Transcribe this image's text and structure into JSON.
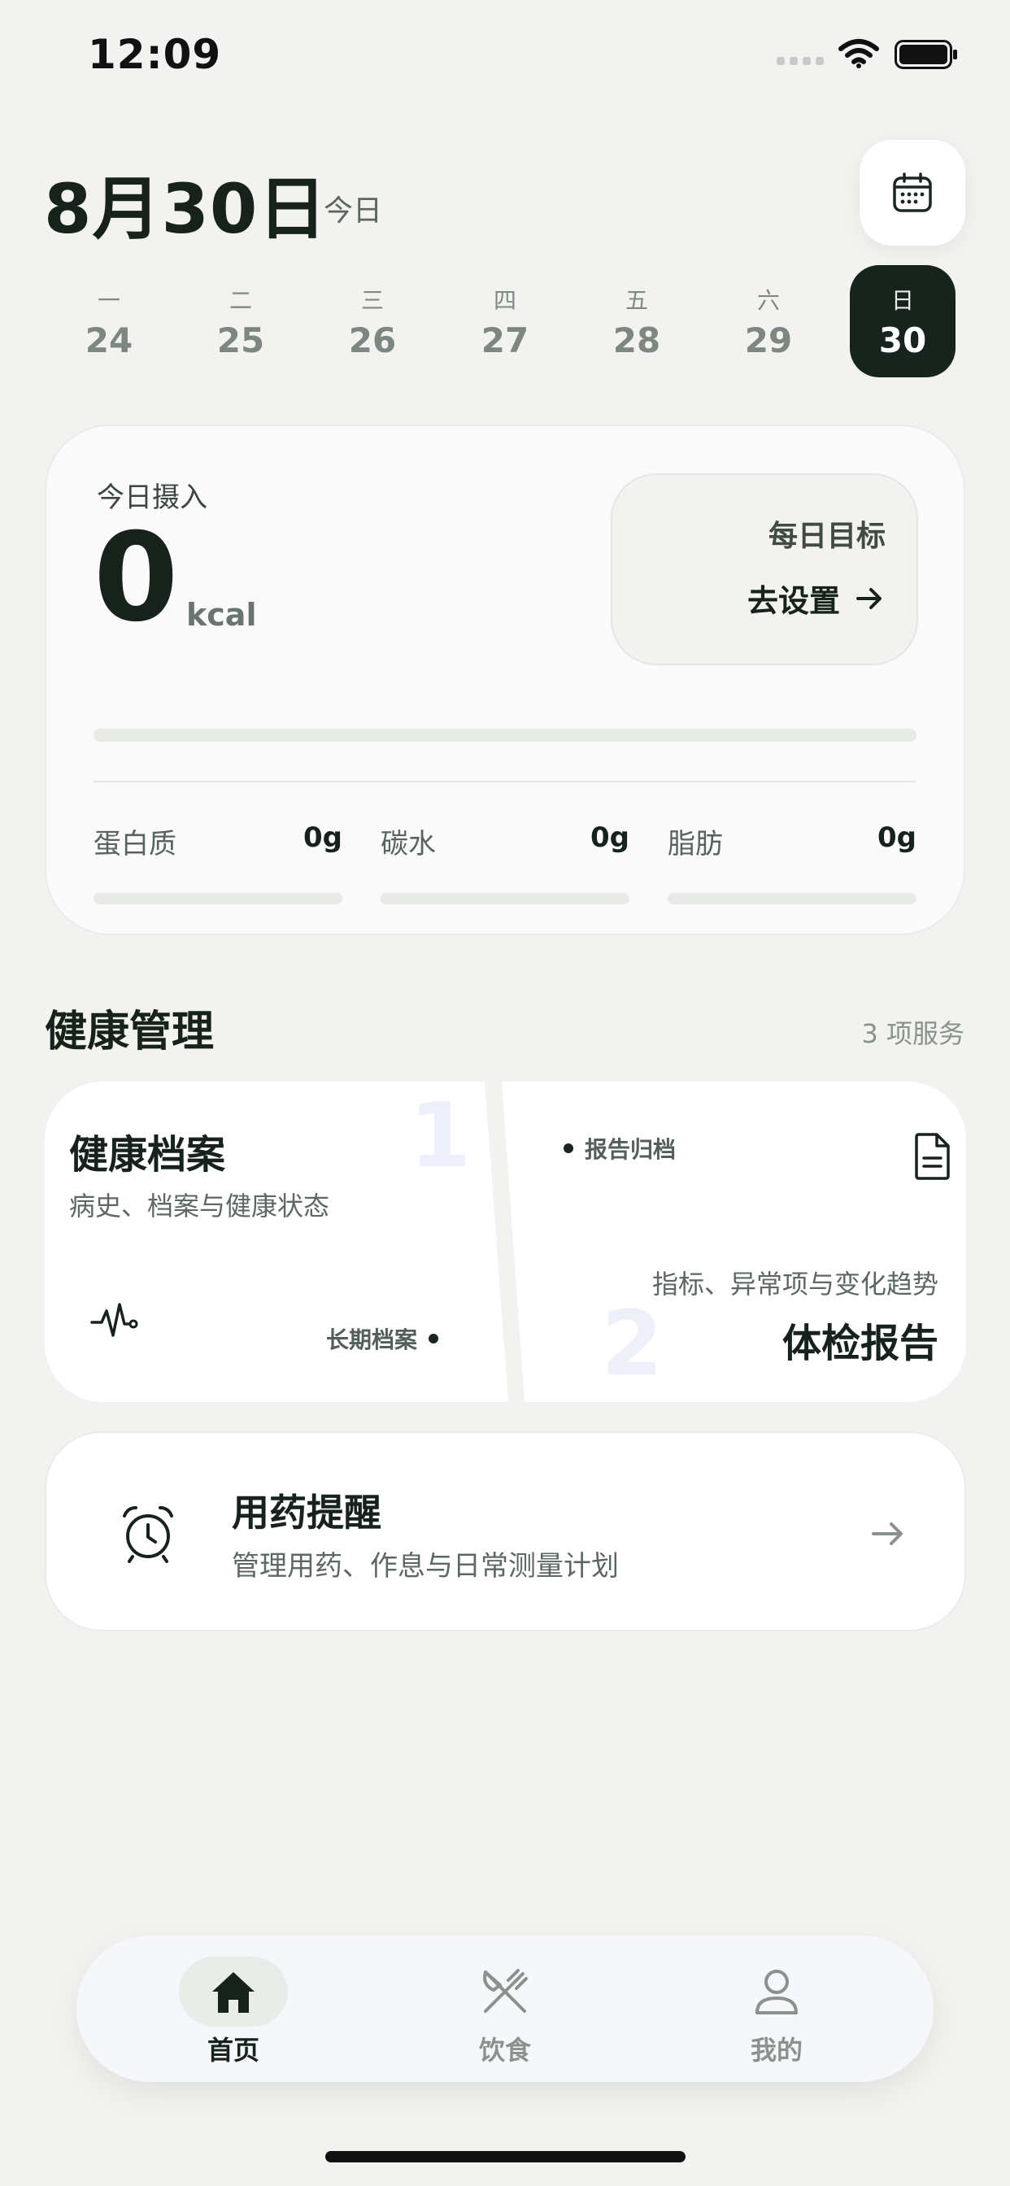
{
  "status_bar": {
    "time": "12:09"
  },
  "header": {
    "date": "8月30日",
    "today_label": "今日"
  },
  "week": [
    {
      "dow": "一",
      "day": "24"
    },
    {
      "dow": "二",
      "day": "25"
    },
    {
      "dow": "三",
      "day": "26"
    },
    {
      "dow": "四",
      "day": "27"
    },
    {
      "dow": "五",
      "day": "28"
    },
    {
      "dow": "六",
      "day": "29"
    },
    {
      "dow": "日",
      "day": "30"
    }
  ],
  "selected_day_index": 6,
  "intake": {
    "label": "今日摄入",
    "value": "0",
    "unit": "kcal",
    "goal_title": "每日目标",
    "goal_action": "去设置",
    "progress": 0,
    "macros": [
      {
        "label": "蛋白质",
        "value": "0g",
        "progress": 0
      },
      {
        "label": "碳水",
        "value": "0g",
        "progress": 0
      },
      {
        "label": "脂肪",
        "value": "0g",
        "progress": 0
      }
    ]
  },
  "health_section": {
    "title": "健康管理",
    "count": "3 项服务",
    "record": {
      "number": "1",
      "title": "健康档案",
      "subtitle": "病史、档案与健康状态",
      "tag": "长期档案",
      "icon": "heartbeat-icon"
    },
    "report": {
      "number": "2",
      "tag": "报告归档",
      "subtitle": "指标、异常项与变化趋势",
      "title": "体检报告",
      "icon": "document-icon"
    }
  },
  "medication": {
    "title": "用药提醒",
    "subtitle": "管理用药、作息与日常测量计划",
    "icon": "alarm-clock-icon"
  },
  "tabbar": [
    {
      "label": "首页",
      "icon": "home-icon"
    },
    {
      "label": "饮食",
      "icon": "utensils-icon"
    },
    {
      "label": "我的",
      "icon": "profile-icon"
    }
  ],
  "colors": {
    "accent_dark": "#16241d",
    "background": "#f2f3f1",
    "card": "#ffffff"
  }
}
